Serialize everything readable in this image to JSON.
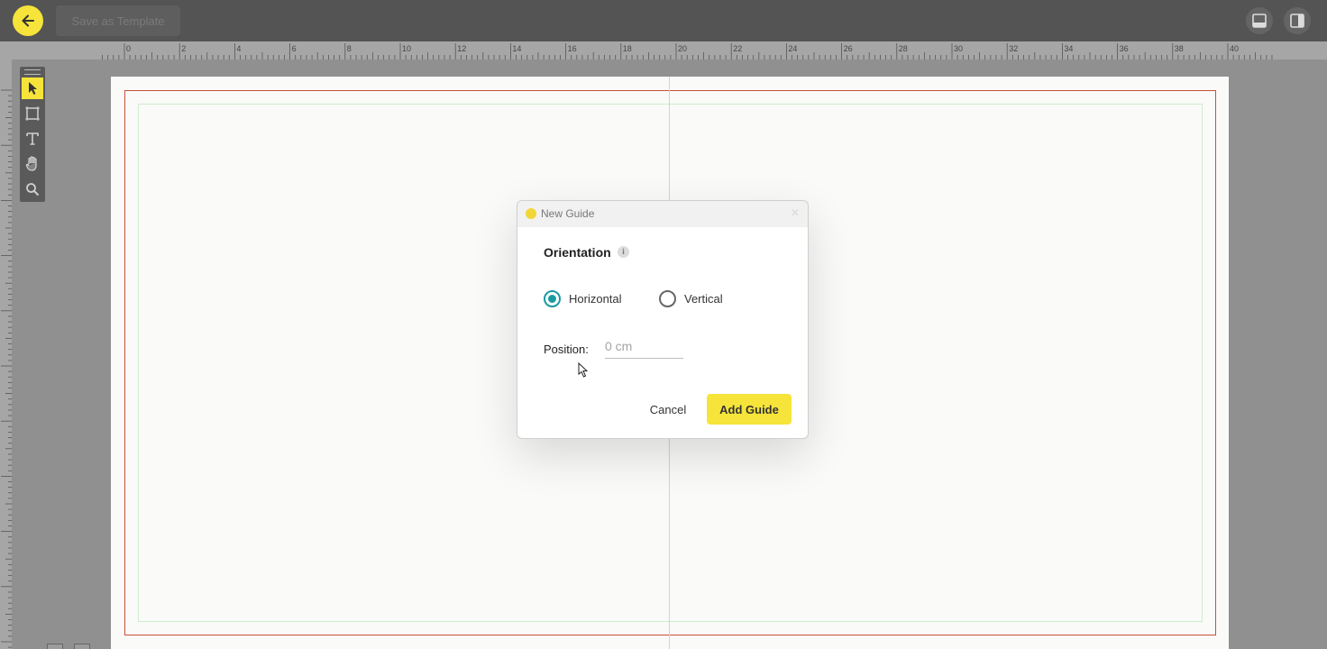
{
  "toolbar": {
    "save_template_label": "Save as Template"
  },
  "ruler": {
    "labels": [
      "0",
      "2",
      "4",
      "6",
      "8",
      "10",
      "12",
      "14",
      "16",
      "18",
      "20",
      "22",
      "24",
      "26",
      "28",
      "30",
      "32",
      "34",
      "36",
      "38",
      "40"
    ]
  },
  "dialog": {
    "title": "New Guide",
    "orientation_label": "Orientation",
    "options": [
      "Horizontal",
      "Vertical"
    ],
    "selected_option": "Horizontal",
    "position_label": "Position:",
    "position_placeholder": "0 cm",
    "cancel_label": "Cancel",
    "add_label": "Add Guide"
  },
  "colors": {
    "accent": "#f6e43a",
    "radio_selected": "#1a9aa0",
    "bleed_line": "#c8503c"
  }
}
